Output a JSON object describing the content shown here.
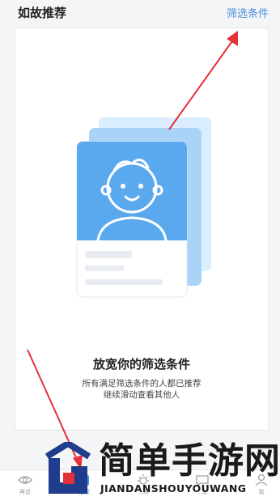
{
  "header": {
    "title": "如故推荐",
    "filter_label": "筛选条件"
  },
  "empty_state": {
    "title": "放宽你的筛选条件",
    "line1": "所有满足筛选条件的人都已推荐",
    "line2": "继续滑动查看其他人"
  },
  "tabbar": {
    "tabs": [
      {
        "label": "再说"
      },
      {
        "label": "推荐"
      },
      {
        "label": "...场"
      },
      {
        "label": "...友"
      },
      {
        "label": "我"
      }
    ]
  },
  "watermark": {
    "cn": "简单手游网",
    "en": "JIANDANSHOUYOUWANG"
  },
  "colors": {
    "accent": "#4a90d9",
    "arrow": "#e6303a",
    "card_blue": "#5aa9ef"
  }
}
